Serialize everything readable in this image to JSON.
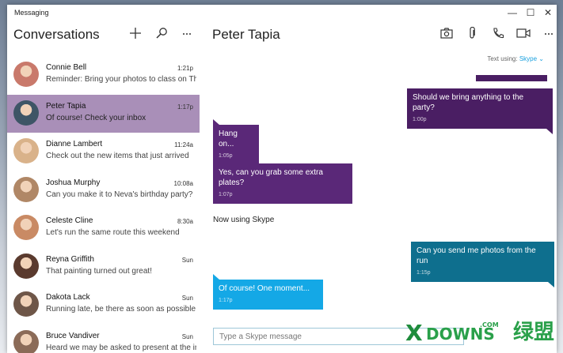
{
  "app": {
    "title": "Messaging"
  },
  "window_controls": {
    "minimize": "—",
    "maximize": "☐",
    "close": "✕"
  },
  "left": {
    "title": "Conversations",
    "icons": [
      "plus-icon",
      "search-icon",
      "more-icon"
    ],
    "conversations": [
      {
        "name": "Connie Bell",
        "time": "1:21p",
        "preview": "Reminder: Bring your photos to class on Thu",
        "avatar": "#c9796b",
        "selected": false
      },
      {
        "name": "Peter Tapia",
        "time": "1:17p",
        "preview": "Of course! Check your inbox",
        "avatar": "#3e5566",
        "selected": true
      },
      {
        "name": "Dianne Lambert",
        "time": "11:24a",
        "preview": "Check out the new items that just arrived",
        "avatar": "#d9b28a",
        "selected": false
      },
      {
        "name": "Joshua Murphy",
        "time": "10:08a",
        "preview": "Can you make it to Neva's birthday party?",
        "avatar": "#b08766",
        "selected": false
      },
      {
        "name": "Celeste Cline",
        "time": "8:30a",
        "preview": "Let's run the same route this weekend",
        "avatar": "#c98a64",
        "selected": false
      },
      {
        "name": "Reyna Griffith",
        "time": "Sun",
        "preview": "That painting turned out great!",
        "avatar": "#5a3a2e",
        "selected": false
      },
      {
        "name": "Dakota Lack",
        "time": "Sun",
        "preview": "Running late, be there as soon as possible",
        "avatar": "#6e5648",
        "selected": false
      },
      {
        "name": "Bruce Vandiver",
        "time": "Sun",
        "preview": "Heard we may be asked to present at the in",
        "avatar": "#8b6b58",
        "selected": false
      }
    ]
  },
  "right": {
    "contact": "Peter Tapia",
    "icons": [
      "camera-icon",
      "attach-icon",
      "phone-icon",
      "video-icon",
      "more-icon"
    ],
    "texting_label": "Text using:",
    "texting_service": "Skype ⌄",
    "notice": "Now using Skype",
    "input_placeholder": "Type a Skype message",
    "messages": [
      {
        "dir": "out",
        "text": "Should we bring anything to the party?",
        "time": "1:00p",
        "color": "#4a1e63"
      },
      {
        "dir": "in",
        "text": "Hang on...",
        "time": "1:05p",
        "color": "#5a2878"
      },
      {
        "dir": "in",
        "text": "Yes, can you grab some extra plates?",
        "time": "1:07p",
        "color": "#5a2878"
      },
      {
        "dir": "out",
        "text": "Can you send me photos from the run",
        "time": "1:15p",
        "color": "#0e6f8e"
      },
      {
        "dir": "in",
        "text": "Of course!  One moment...",
        "time": "1:17p",
        "color": "#14a8e6"
      }
    ]
  },
  "watermark": {
    "x": "X",
    "main": "DOWNS",
    "com": ".COM",
    "cn": "绿盟"
  },
  "colors": {
    "selected_row": "#a98fb8",
    "accent": "#1aa0de"
  }
}
